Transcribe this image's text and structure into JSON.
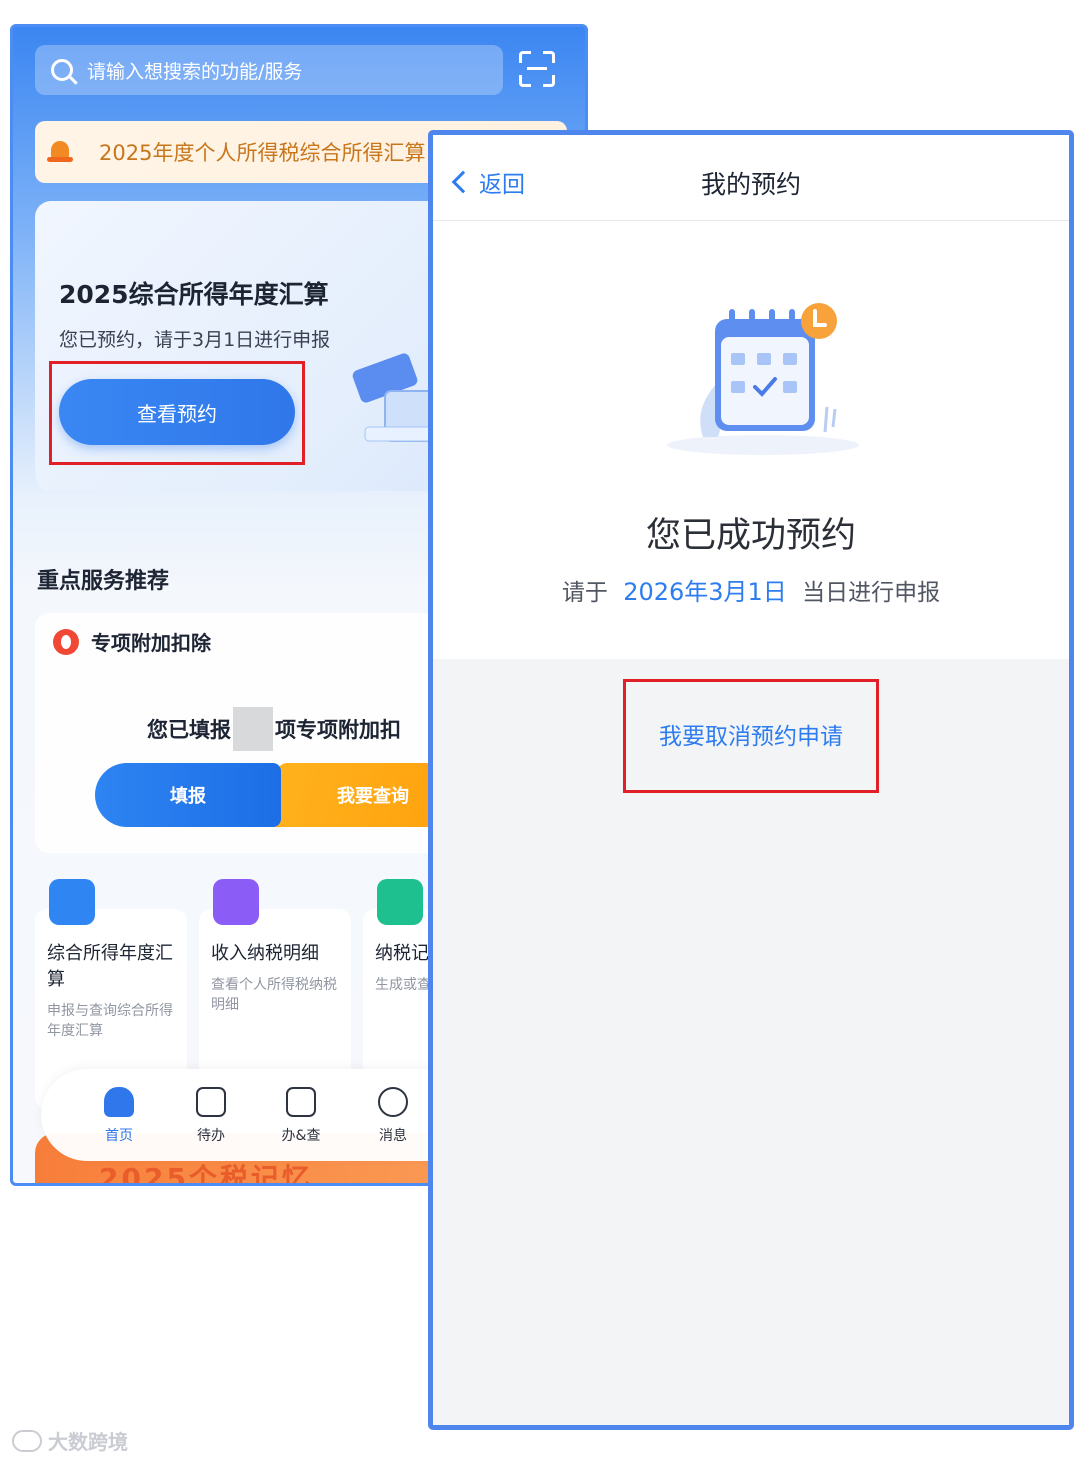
{
  "left_app": {
    "search_placeholder": "请输入想搜索的功能/服务",
    "notice_text": "2025年度个人所得税综合所得汇算",
    "hero": {
      "title": "2025综合所得年度汇算",
      "subtitle": "您已预约，请于3月1日进行申报",
      "button": "查看预约"
    },
    "section_title": "重点服务推荐",
    "deduction": {
      "title": "专项附加扣除",
      "text_before": "您已填报",
      "text_after": "项专项附加扣",
      "fill_button": "填报",
      "query_button": "我要查询"
    },
    "cards": [
      {
        "title": "综合所得年度汇算",
        "desc": "申报与查询综合所得年度汇算",
        "color": "#2f86f2"
      },
      {
        "title": "收入纳税明细",
        "desc": "查看个人所得税纳税明细",
        "color": "#8b5cf6"
      },
      {
        "title": "纳税记",
        "desc": "生成或查录",
        "color": "#1fc08f"
      }
    ],
    "tabs": [
      {
        "label": "首页",
        "icon": "home-icon"
      },
      {
        "label": "待办",
        "icon": "calendar-check-icon"
      },
      {
        "label": "办&查",
        "icon": "form-search-icon"
      },
      {
        "label": "消息",
        "icon": "message-icon"
      }
    ],
    "banner_text": "2025个税记忆"
  },
  "right_app": {
    "back_label": "返回",
    "page_title": "我的预约",
    "success_title": "您已成功预约",
    "sub_prefix": "请于",
    "sub_date": "2026年3月1日",
    "sub_suffix": "当日进行申报",
    "cancel_label": "我要取消预约申请"
  },
  "watermark": "大数跨境",
  "colors": {
    "accent": "#2d7cf0",
    "highlight_box": "#e01f26",
    "panel_border": "#4f86ee"
  }
}
